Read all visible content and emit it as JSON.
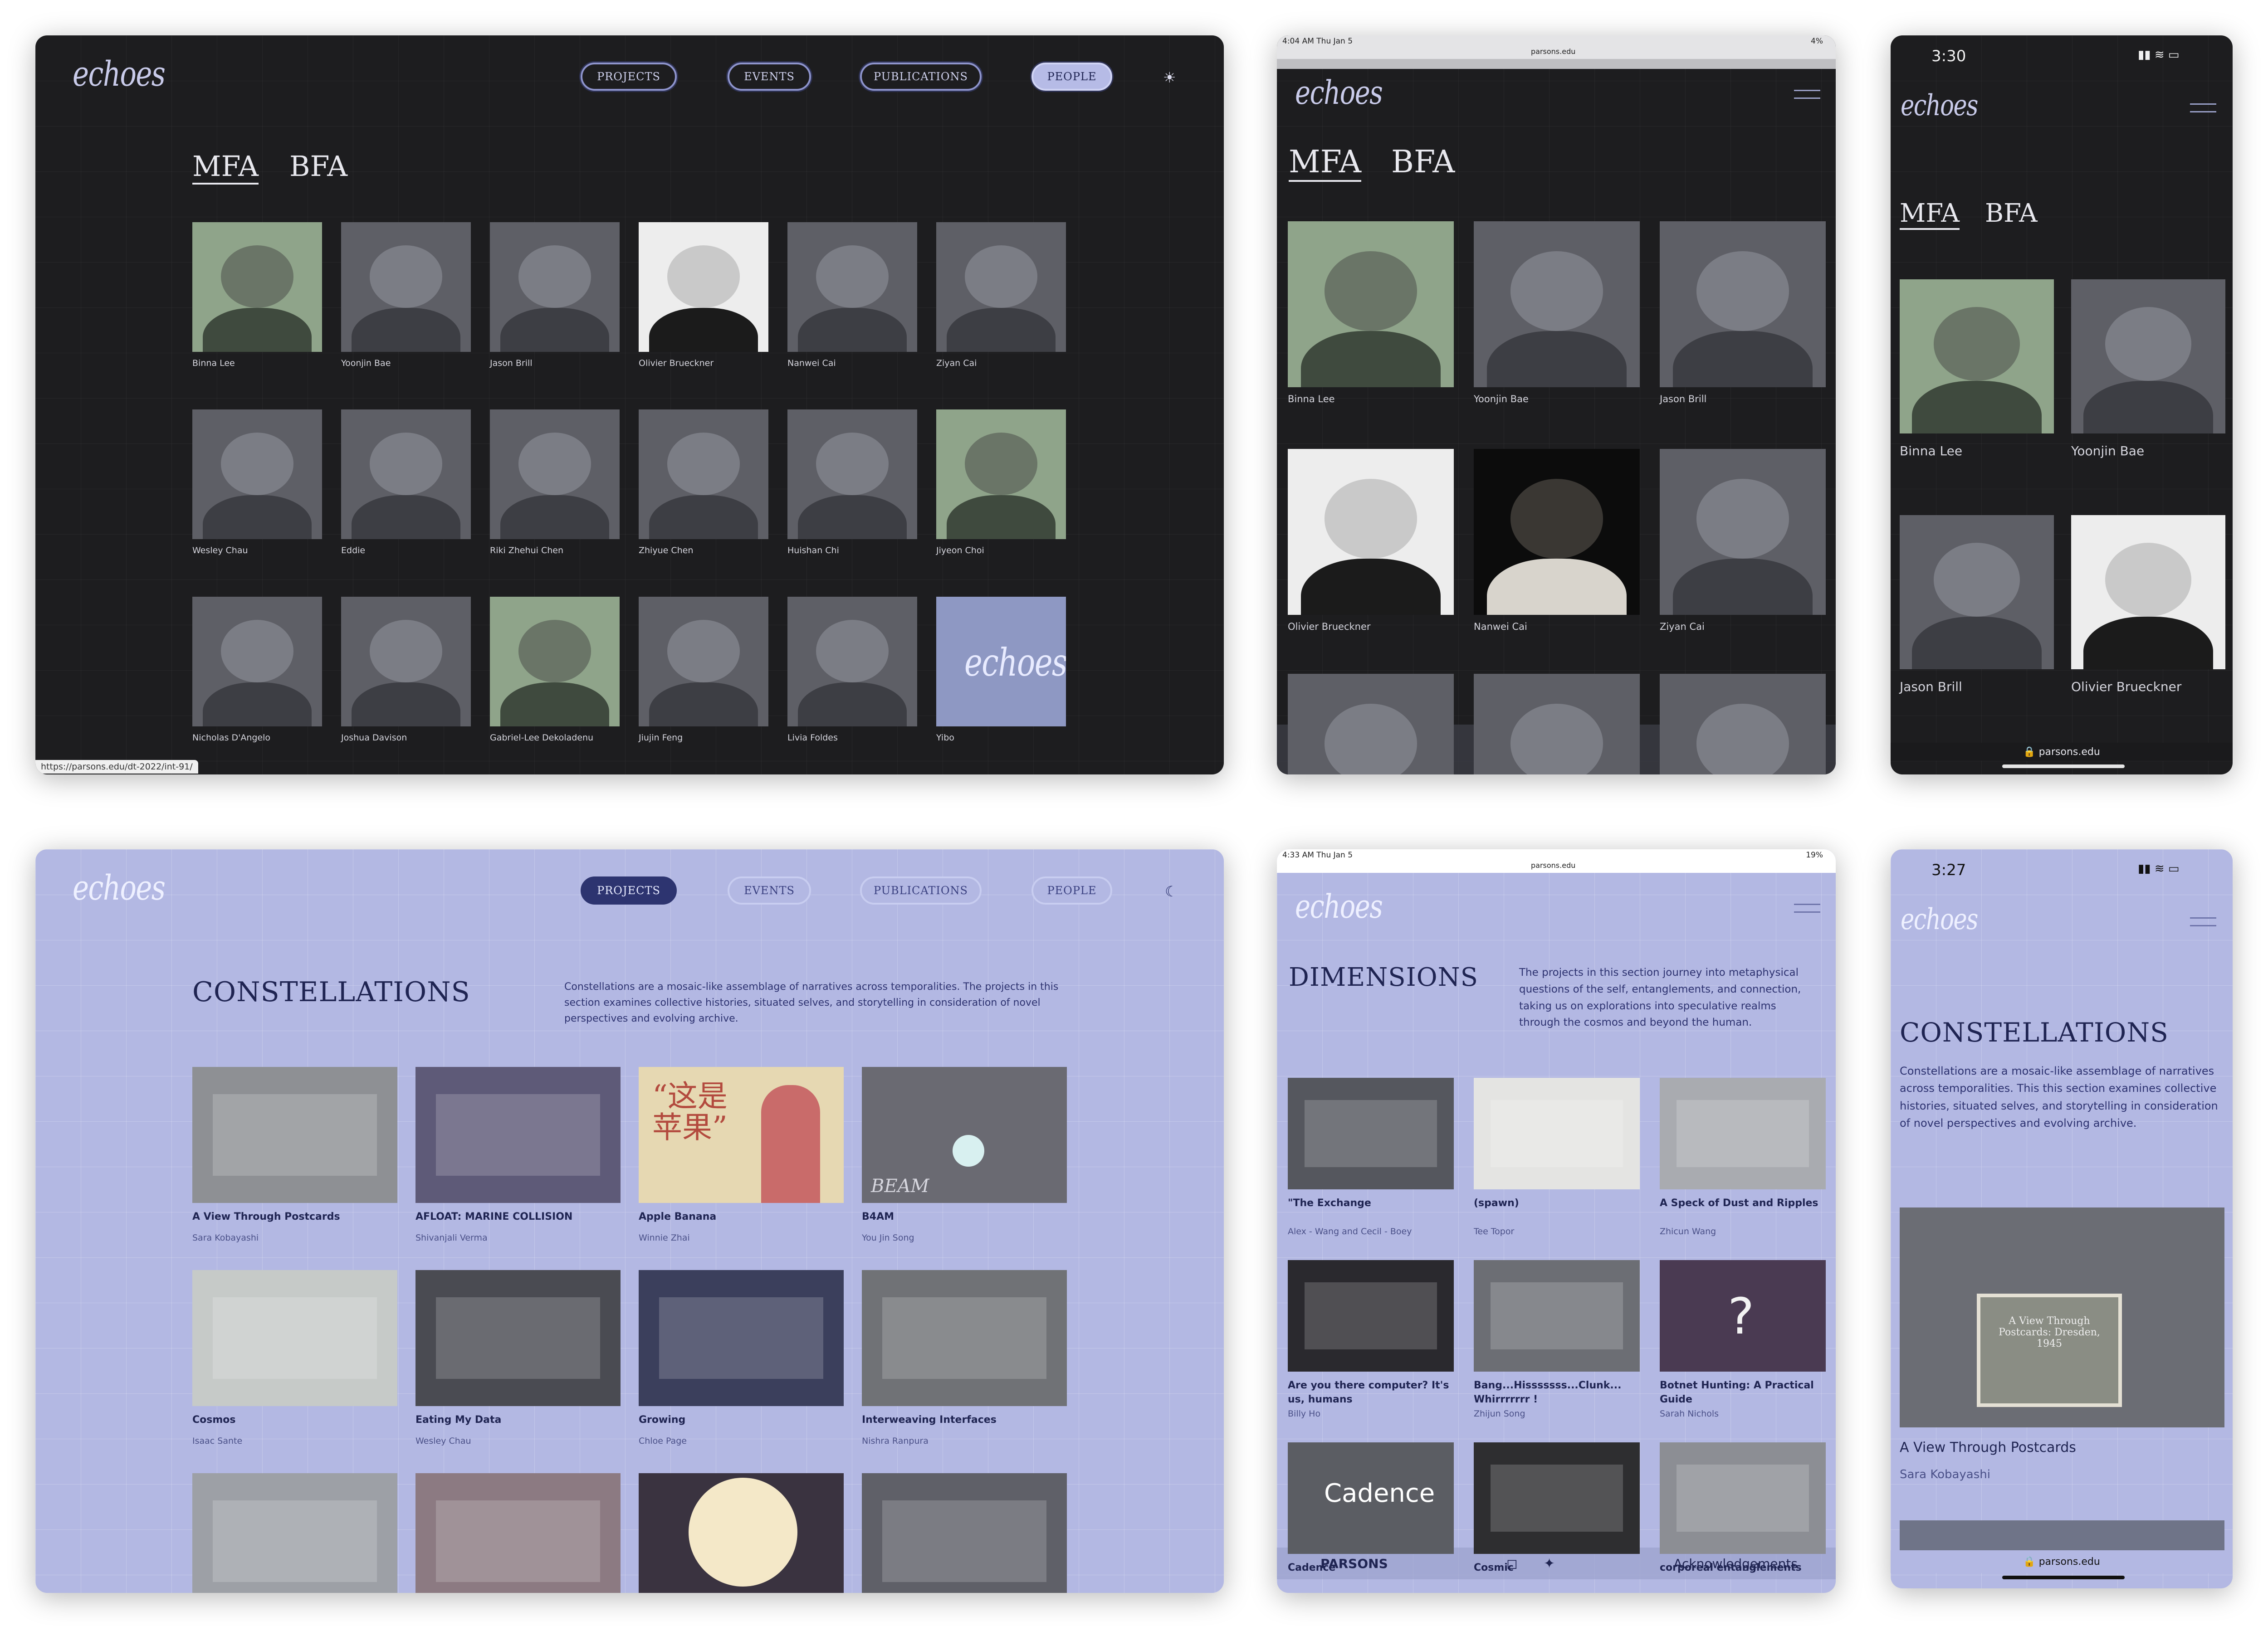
{
  "brand": {
    "logo": "echoes",
    "hover_url": "https://parsons.edu/dt-2022/int-91/",
    "url": "parsons.edu",
    "footer_left": "PARSONS",
    "footer_right": "Acknowledgements"
  },
  "nav": {
    "projects": "PROJECTS",
    "events": "EVENTS",
    "publications": "PUBLICATIONS",
    "people": "PEOPLE"
  },
  "tabs": {
    "mfa": "MFA",
    "bfa": "BFA"
  },
  "people": [
    "Binna Lee",
    "Yoonjin Bae",
    "Jason Brill",
    "Olivier Brueckner",
    "Nanwei Cai",
    "Ziyan Cai",
    "Wesley Chau",
    "Eddie",
    "Riki Zhehui Chen",
    "Zhiyue Chen",
    "Huishan Chi",
    "Jiyeon Choi",
    "Nicholas D'Angelo",
    "Joshua Davison",
    "Gabriel-Lee Dekoladenu",
    "Jiujin Feng",
    "Livia Foldes",
    "Yibo"
  ],
  "tablet_dark": {
    "time": "4:04 AM  Thu Jan 5",
    "battery": "4%",
    "people": [
      "Binna Lee",
      "Yoonjin Bae",
      "Jason Brill",
      "Olivier Brueckner",
      "Nanwei Cai",
      "Ziyan Cai"
    ]
  },
  "phone_dark": {
    "time": "3:30",
    "people": [
      "Binna Lee",
      "Yoonjin Bae",
      "Jason Brill",
      "Olivier Brueckner"
    ]
  },
  "constellations": {
    "title": "CONSTELLATIONS",
    "description": "Constellations are a mosaic-like assemblage of narratives across temporalities. The projects in this section examines collective histories, situated selves, and storytelling in consideration of novel perspectives and evolving archive.",
    "projects": [
      {
        "title": "A View Through Postcards",
        "author": "Sara Kobayashi"
      },
      {
        "title": "AFLOAT: MARINE COLLISION",
        "author": "Shivanjali Verma"
      },
      {
        "title": "Apple Banana",
        "author": "Winnie Zhai"
      },
      {
        "title": "B4AM",
        "author": "You Jin Song"
      },
      {
        "title": "Cosmos",
        "author": "Isaac Sante"
      },
      {
        "title": "Eating My Data",
        "author": "Wesley Chau"
      },
      {
        "title": "Growing",
        "author": "Chloe Page"
      },
      {
        "title": "Interweaving Interfaces",
        "author": "Nishra Ranpura"
      }
    ],
    "mobile_description": "Constellations are a mosaic-like assemblage of narratives across temporalities. This this section examines collective histories, situated selves, and storytelling in consideration of novel perspectives and evolving archive."
  },
  "tile_text": {
    "apple_banana": "“这是\n苹果”",
    "b4am": "BEAM",
    "postcard": "A View Through Postcards: Dresden, 1945",
    "cadence": "Cadence"
  },
  "dimensions": {
    "time": "4:33 AM  Thu Jan 5",
    "battery": "19%",
    "title": "DIMENSIONS",
    "description": "The projects in this section journey into metaphysical questions of the self, entanglements, and connection, taking us on explorations into speculative realms through the cosmos and beyond the human.",
    "projects": [
      {
        "title": "\"The Exchange",
        "author": "Alex - Wang and Cecil - Boey"
      },
      {
        "title": "(spawn)",
        "author": "Tee Topor"
      },
      {
        "title": "A Speck of Dust and Ripples",
        "author": "Zhicun Wang"
      },
      {
        "title": "Are you there computer? It's us, humans",
        "author": "Billy Ho"
      },
      {
        "title": "Bang...Hisssssss...Clunk... Whirrrrrrr !",
        "author": "Zhijun Song"
      },
      {
        "title": "Botnet Hunting: A Practical Guide",
        "author": "Sarah Nichols"
      },
      {
        "title": "Cadence",
        "author": ""
      },
      {
        "title": "Cosmic",
        "author": ""
      },
      {
        "title": "corporeal entanglements",
        "author": ""
      }
    ]
  },
  "phone_light": {
    "time": "3:27",
    "project_title": "A View Through Postcards",
    "project_author": "Sara Kobayashi"
  },
  "colors": {
    "dark_bg": "#1d1d1f",
    "light_bg": "#b3b8e3",
    "accent": "#2d3470"
  }
}
